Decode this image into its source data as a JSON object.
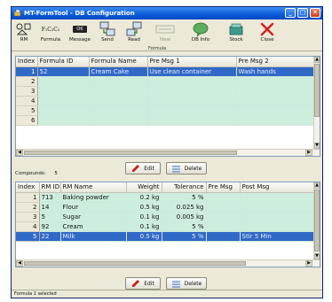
{
  "window": {
    "title": "MT-FormTool - DB Configuration",
    "controls": {
      "minimize": "_",
      "maximize": "□",
      "close": "✕"
    }
  },
  "toolbar": {
    "items": [
      {
        "label": "RM",
        "icon": "raw-material-icon",
        "enabled": true
      },
      {
        "label": "Formula",
        "icon": "formula-icon",
        "enabled": true
      },
      {
        "label": "Message",
        "icon": "message-icon",
        "enabled": true
      },
      {
        "label": "Send",
        "icon": "send-icon",
        "enabled": true
      },
      {
        "label": "Read",
        "icon": "read-icon",
        "enabled": true
      },
      {
        "label": "New",
        "icon": "new-icon",
        "enabled": false
      },
      {
        "label": "DB Info",
        "icon": "db-info-icon",
        "enabled": true
      },
      {
        "label": "Stock",
        "icon": "stock-icon",
        "enabled": true
      },
      {
        "label": "Close",
        "icon": "close-icon",
        "enabled": true
      }
    ],
    "formula_icon_text": "F₁C₂C₃",
    "message_icon_text": "OK",
    "group_label": "Formula"
  },
  "formula_table": {
    "columns": [
      "Index",
      "Formula ID",
      "Formula Name",
      "Pre Msg 1",
      "Pre Msg 2"
    ],
    "rows": [
      {
        "index": "1",
        "id": "52",
        "name": "Cream Cake",
        "msg1": "Use clean container",
        "msg2": "Wash hands",
        "selected": true
      },
      {
        "index": "2",
        "id": "",
        "name": "",
        "msg1": "",
        "msg2": "",
        "selected": false
      },
      {
        "index": "3",
        "id": "",
        "name": "",
        "msg1": "",
        "msg2": "",
        "selected": false
      },
      {
        "index": "4",
        "id": "",
        "name": "",
        "msg1": "",
        "msg2": "",
        "selected": false
      },
      {
        "index": "5",
        "id": "",
        "name": "",
        "msg1": "",
        "msg2": "",
        "selected": false
      },
      {
        "index": "6",
        "id": "",
        "name": "",
        "msg1": "",
        "msg2": "",
        "selected": false
      }
    ]
  },
  "compounds": {
    "label": "Compounds:",
    "count": "5"
  },
  "buttons": {
    "edit": "Edit",
    "delete": "Delete"
  },
  "rm_table": {
    "columns": [
      "Index",
      "RM ID",
      "RM Name",
      "Weight",
      "Tolerance",
      "Pre Msg",
      "Post Msg"
    ],
    "rows": [
      {
        "index": "1",
        "id": "713",
        "name": "Baking powder",
        "weight": "0.2 kg",
        "tolerance": "5 %",
        "pre": "",
        "post": "",
        "selected": false
      },
      {
        "index": "2",
        "id": "14",
        "name": "Flour",
        "weight": "0.5 kg",
        "tolerance": "0.025 kg",
        "pre": "",
        "post": "",
        "selected": false
      },
      {
        "index": "3",
        "id": "5",
        "name": "Sugar",
        "weight": "0.1 kg",
        "tolerance": "0.005 kg",
        "pre": "",
        "post": "",
        "selected": false
      },
      {
        "index": "4",
        "id": "92",
        "name": "Cream",
        "weight": "0.1 kg",
        "tolerance": "5 %",
        "pre": "",
        "post": "",
        "selected": false
      },
      {
        "index": "5",
        "id": "22",
        "name": "Milk",
        "weight": "0.5 kg",
        "tolerance": "5 %",
        "pre": "",
        "post": "Stir 5 Min",
        "selected": true
      }
    ]
  },
  "status": {
    "text": "Formula 1 selected"
  },
  "colors": {
    "selection": "#3169c6",
    "row_bg": "#cdeedd",
    "titlebar": "#0a5bd8"
  }
}
